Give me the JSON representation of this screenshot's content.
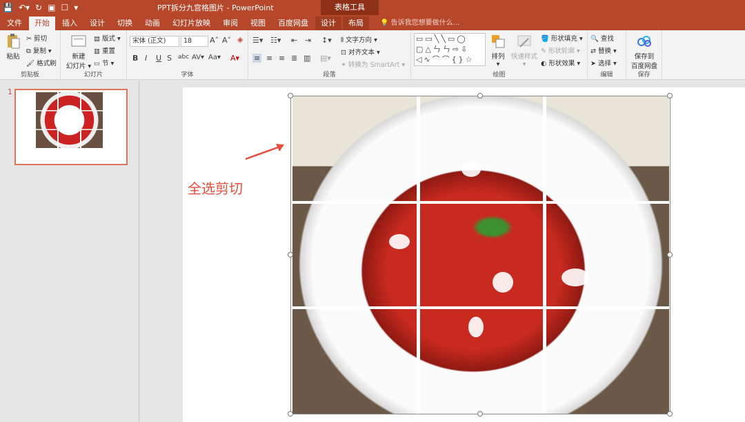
{
  "window": {
    "title": "PPT拆分九宫格图片 - PowerPoint",
    "context_group": "表格工具"
  },
  "tabs": [
    {
      "label": "文件"
    },
    {
      "label": "开始"
    },
    {
      "label": "插入"
    },
    {
      "label": "设计"
    },
    {
      "label": "切换"
    },
    {
      "label": "动画"
    },
    {
      "label": "幻灯片放映"
    },
    {
      "label": "审阅"
    },
    {
      "label": "视图"
    },
    {
      "label": "百度网盘"
    },
    {
      "label": "设计"
    },
    {
      "label": "布局"
    }
  ],
  "tellme": "告诉我您想要做什么...",
  "ribbon": {
    "clipboard": {
      "label": "剪贴板",
      "paste": "粘贴",
      "cut": "剪切",
      "copy": "复制",
      "format_painter": "格式刷"
    },
    "slides": {
      "label": "幻灯片",
      "new_slide_line1": "新建",
      "new_slide_line2": "幻灯片",
      "layout": "版式",
      "reset": "重置",
      "section": "节"
    },
    "font": {
      "label": "字体",
      "font_name": "宋体 (正文)",
      "font_size": "18"
    },
    "paragraph": {
      "label": "段落",
      "text_direction": "文字方向",
      "align_text": "对齐文本",
      "smartart": "转换为 SmartArt"
    },
    "drawing": {
      "label": "绘图",
      "arrange": "排列",
      "quick_styles": "快速样式",
      "shape_fill": "形状填充",
      "shape_outline": "形状轮廓",
      "shape_effects": "形状效果"
    },
    "editing": {
      "label": "编辑",
      "find": "查找",
      "replace": "替换",
      "select": "选择"
    },
    "save": {
      "label": "保存",
      "save_line1": "保存到",
      "save_line2": "百度网盘"
    }
  },
  "thumbnails": [
    {
      "number": "1"
    }
  ],
  "slide": {
    "caption": "全选剪切"
  },
  "colors": {
    "accent": "#b7472a",
    "caption": "#e74c3c"
  }
}
